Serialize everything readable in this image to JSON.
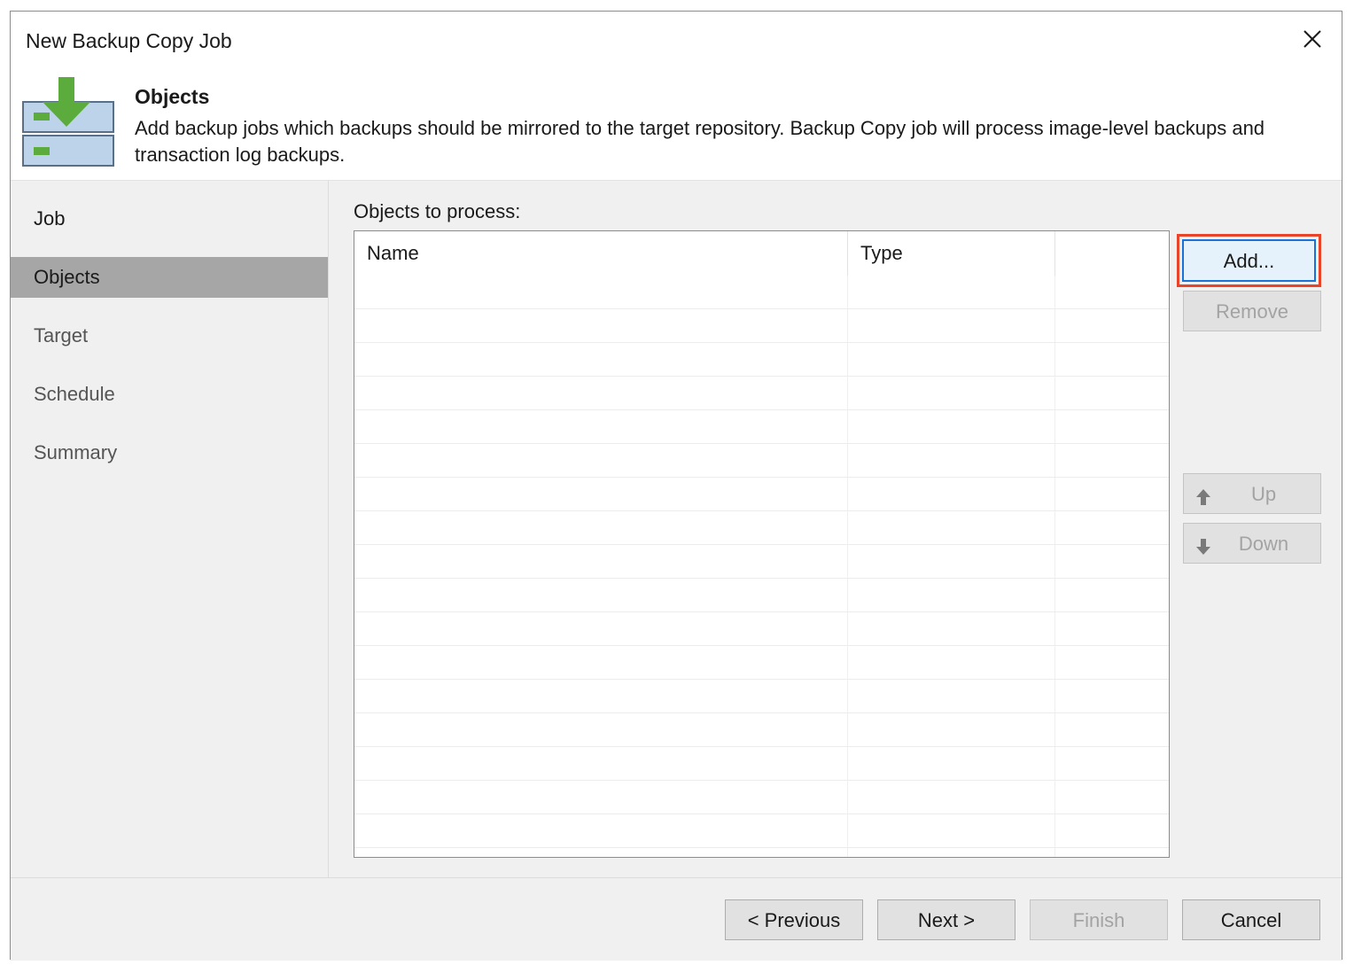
{
  "window": {
    "title": "New Backup Copy Job"
  },
  "icons": {
    "close": "close-icon",
    "header": "backup-copy-icon",
    "up": "arrow-up-icon",
    "down": "arrow-down-icon"
  },
  "colors": {
    "accent_green": "#5cac3d",
    "focus_red": "#e8442a",
    "focus_blue": "#1a72d8",
    "selected_nav": "#a6a6a6"
  },
  "header": {
    "title": "Objects",
    "description": "Add backup jobs which backups should be mirrored to the target repository. Backup Copy job will process image-level backups and transaction log backups."
  },
  "sidebar": {
    "items": [
      {
        "label": "Job"
      },
      {
        "label": "Objects"
      },
      {
        "label": "Target"
      },
      {
        "label": "Schedule"
      },
      {
        "label": "Summary"
      }
    ]
  },
  "objects": {
    "label": "Objects to process:",
    "columns": [
      "Name",
      "Type",
      ""
    ],
    "rows": []
  },
  "side_buttons": {
    "add": "Add...",
    "remove": "Remove",
    "up": "Up",
    "down": "Down"
  },
  "footer": {
    "previous": "< Previous",
    "next": "Next >",
    "finish": "Finish",
    "cancel": "Cancel"
  }
}
